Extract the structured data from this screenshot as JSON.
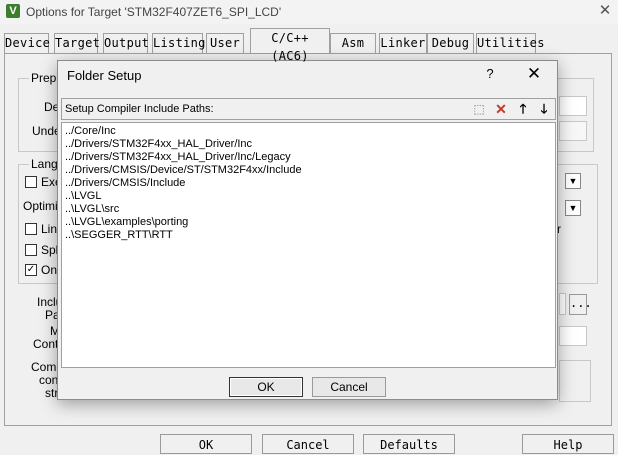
{
  "window": {
    "icon_letter": "V",
    "title": "Options for Target 'STM32F407ZET6_SPI_LCD'",
    "close_glyph": "✕"
  },
  "tabs": [
    {
      "label": "Device"
    },
    {
      "label": "Target"
    },
    {
      "label": "Output"
    },
    {
      "label": "Listing"
    },
    {
      "label": "User"
    },
    {
      "label": "C/C++ (AC6)"
    },
    {
      "label": "Asm"
    },
    {
      "label": "Linker"
    },
    {
      "label": "Debug"
    },
    {
      "label": "Utilities"
    }
  ],
  "background_labels": {
    "prepro": "Prepro",
    "def": "Def",
    "undef": "Undef",
    "langu": "Langu",
    "exe": "Exe",
    "optimiz": "Optimiz",
    "link": "Link",
    "spli": "Spli",
    "one": "One",
    "inclu": "Inclu",
    "pat": "Pat",
    "m": "M",
    "contr": "Contr",
    "comp": "Comp",
    "cont": "cont",
    "str": "str",
    "r_char": "r",
    "ellipsis": "..."
  },
  "bottom_buttons": {
    "ok": "OK",
    "cancel": "Cancel",
    "defaults": "Defaults",
    "help": "Help"
  },
  "dialog": {
    "title": "Folder Setup",
    "help_glyph": "?",
    "close_glyph": "✕",
    "list_header": "Setup Compiler Include Paths:",
    "toolbar": {
      "new_glyph": "⬚",
      "delete_glyph": "✕",
      "up_glyph": "🡑",
      "down_glyph": "🡓"
    },
    "paths": [
      "../Core/Inc",
      "../Drivers/STM32F4xx_HAL_Driver/Inc",
      "../Drivers/STM32F4xx_HAL_Driver/Inc/Legacy",
      "../Drivers/CMSIS/Device/ST/STM32F4xx/Include",
      "../Drivers/CMSIS/Include",
      "..\\LVGL",
      "..\\LVGL\\src",
      "..\\LVGL\\examples\\porting",
      "..\\SEGGER_RTT\\RTT"
    ],
    "ok_label": "OK",
    "cancel_label": "Cancel"
  },
  "colors": {
    "accent_red": "#c0392b",
    "icon_green": "#3b7f2c"
  }
}
